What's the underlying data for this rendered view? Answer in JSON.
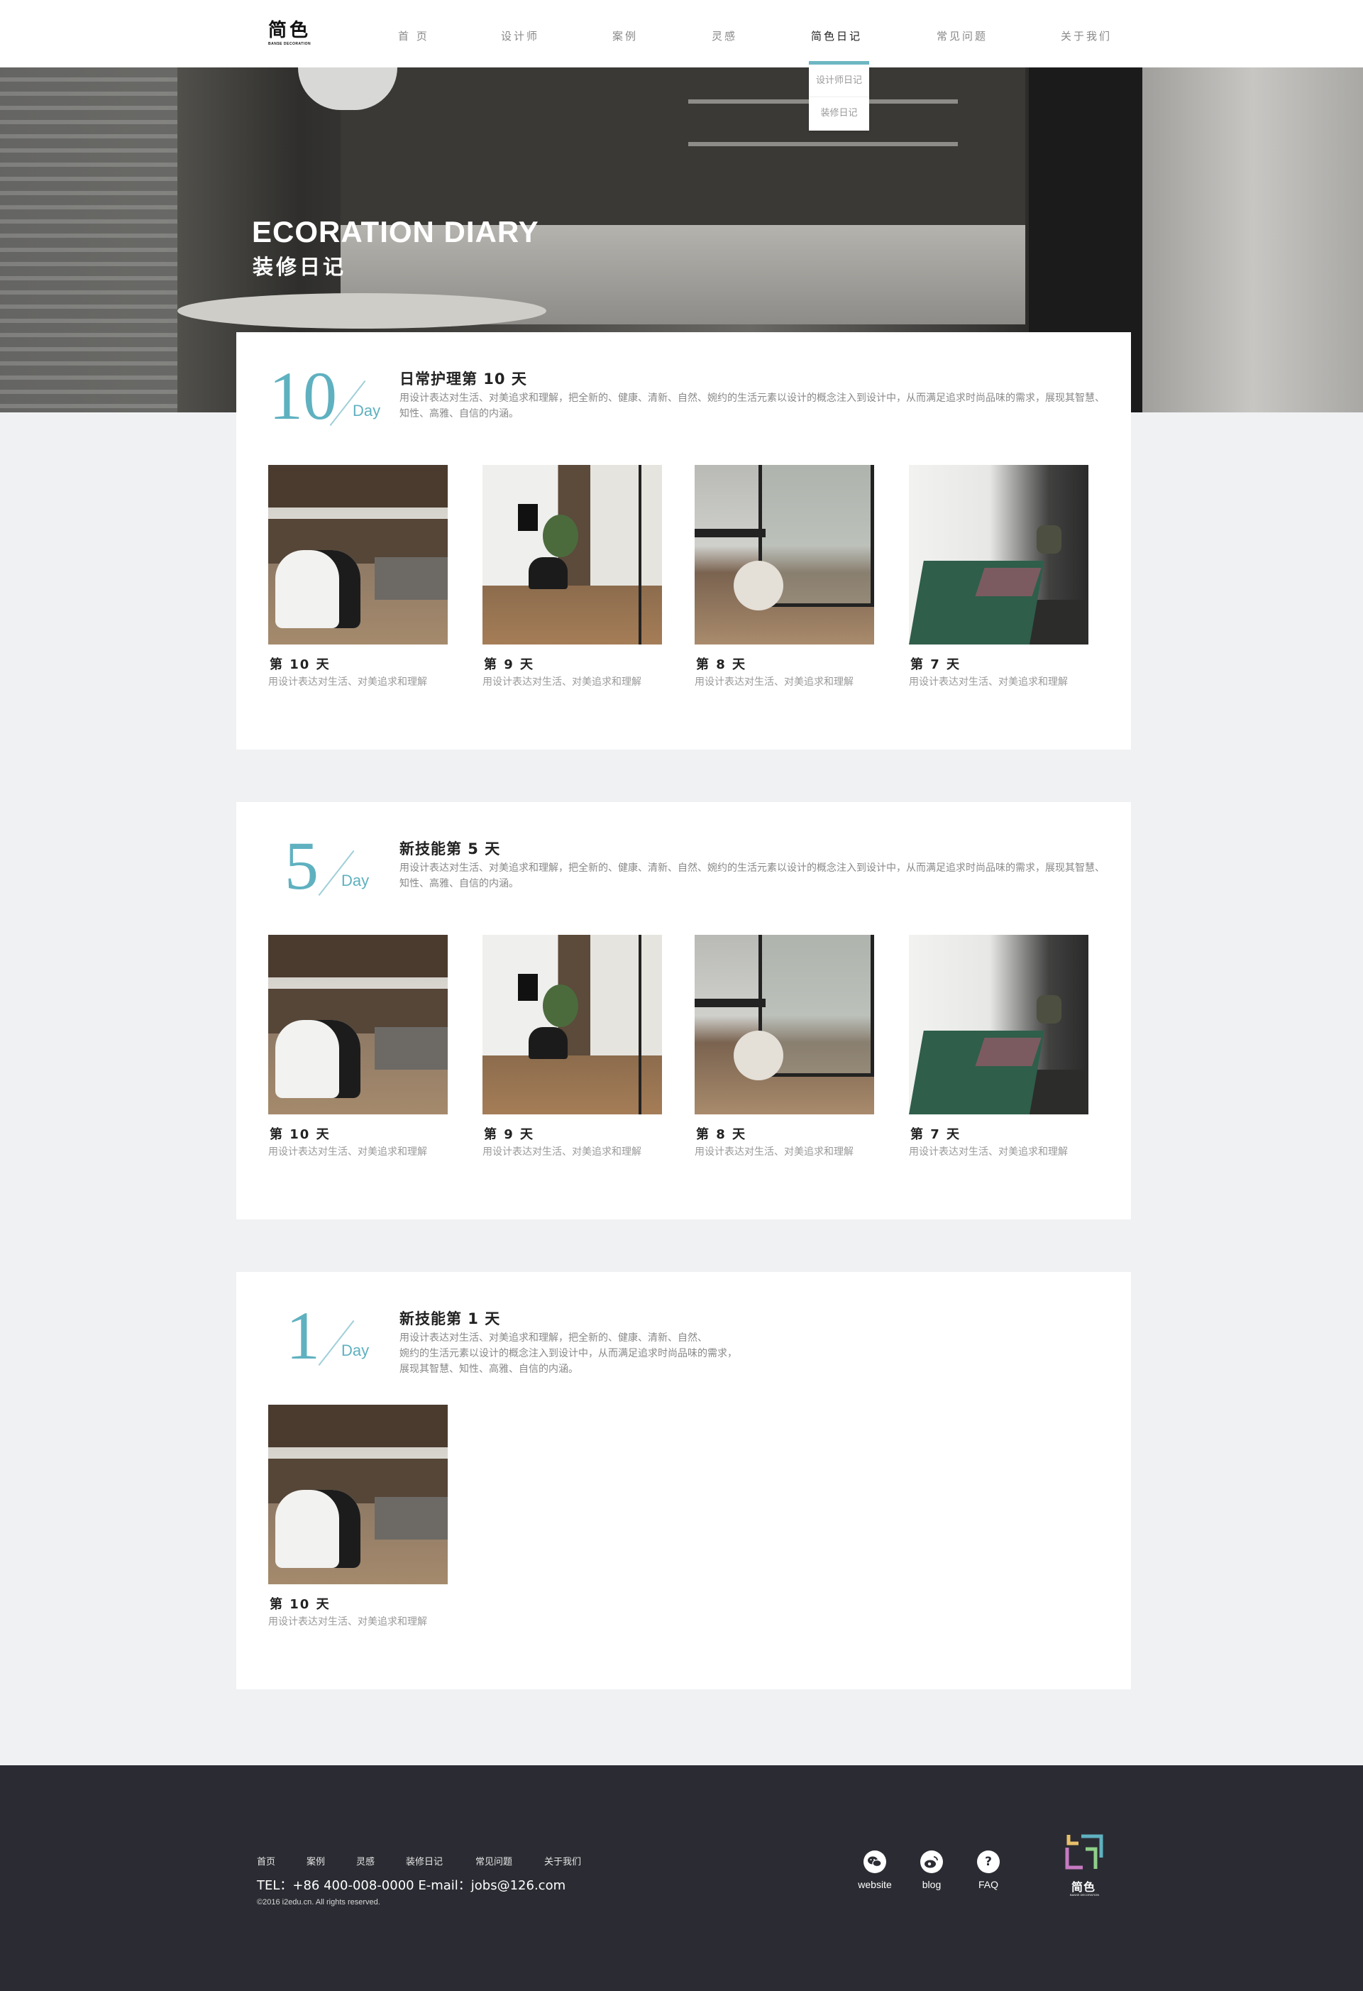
{
  "header": {
    "logo_cn": "简色",
    "logo_en": "BANSE DECORATION",
    "nav": [
      "首 页",
      "设计师",
      "案例",
      "灵感",
      "简色日记",
      "常见问题",
      "关于我们"
    ],
    "active_nav": "简色日记",
    "dropdown": [
      "设计师日记",
      "装修日记"
    ]
  },
  "banner": {
    "title_en": "ECORATION DIARY",
    "title_cn": "装修日记"
  },
  "cards": [
    {
      "day": "10",
      "day_label": "Day",
      "title": "日常护理第 10 天",
      "desc": "用设计表达对生活、对美追求和理解，把全新的、健康、清新、自然、婉约的生活元素以设计的概念注入到设计中，从而满足追求时尚品味的需求，展现其智慧、知性、高雅、自信的内涵。",
      "items": [
        {
          "caption": "第 10 天",
          "sub": "用设计表达对生活、对美追求和理解"
        },
        {
          "caption": "第 9 天",
          "sub": "用设计表达对生活、对美追求和理解"
        },
        {
          "caption": "第 8 天",
          "sub": "用设计表达对生活、对美追求和理解"
        },
        {
          "caption": "第 7 天",
          "sub": "用设计表达对生活、对美追求和理解"
        }
      ]
    },
    {
      "day": "5",
      "day_label": "Day",
      "title": "新技能第 5 天",
      "desc": "用设计表达对生活、对美追求和理解，把全新的、健康、清新、自然、婉约的生活元素以设计的概念注入到设计中，从而满足追求时尚品味的需求，展现其智慧、知性、高雅、自信的内涵。",
      "items": [
        {
          "caption": "第 10 天",
          "sub": "用设计表达对生活、对美追求和理解"
        },
        {
          "caption": "第 9 天",
          "sub": "用设计表达对生活、对美追求和理解"
        },
        {
          "caption": "第 8 天",
          "sub": "用设计表达对生活、对美追求和理解"
        },
        {
          "caption": "第 7 天",
          "sub": "用设计表达对生活、对美追求和理解"
        }
      ]
    },
    {
      "day": "1",
      "day_label": "Day",
      "title": "新技能第 1 天",
      "desc_lines": [
        "用设计表达对生活、对美追求和理解，把全新的、健康、清新、自然、",
        "婉约的生活元素以设计的概念注入到设计中，从而满足追求时尚品味的需求，",
        "展现其智慧、知性、高雅、自信的内涵。"
      ],
      "items": [
        {
          "caption": "第 10 天",
          "sub": "用设计表达对生活、对美追求和理解"
        }
      ]
    }
  ],
  "footer": {
    "nav": [
      "首页",
      "案例",
      "灵感",
      "装修日记",
      "常见问题",
      "关于我们"
    ],
    "contact": "TEL：+86 400-008-0000    E-mail：jobs@126.com",
    "copyright": "©2016 i2edu.cn. All rights reserved.",
    "social": [
      {
        "label": "website",
        "icon": "wechat-icon"
      },
      {
        "label": "blog",
        "icon": "weibo-icon"
      },
      {
        "label": "FAQ",
        "icon": "question-icon"
      }
    ],
    "logo_cn": "简色",
    "logo_en": "BANSE DECORATION"
  }
}
